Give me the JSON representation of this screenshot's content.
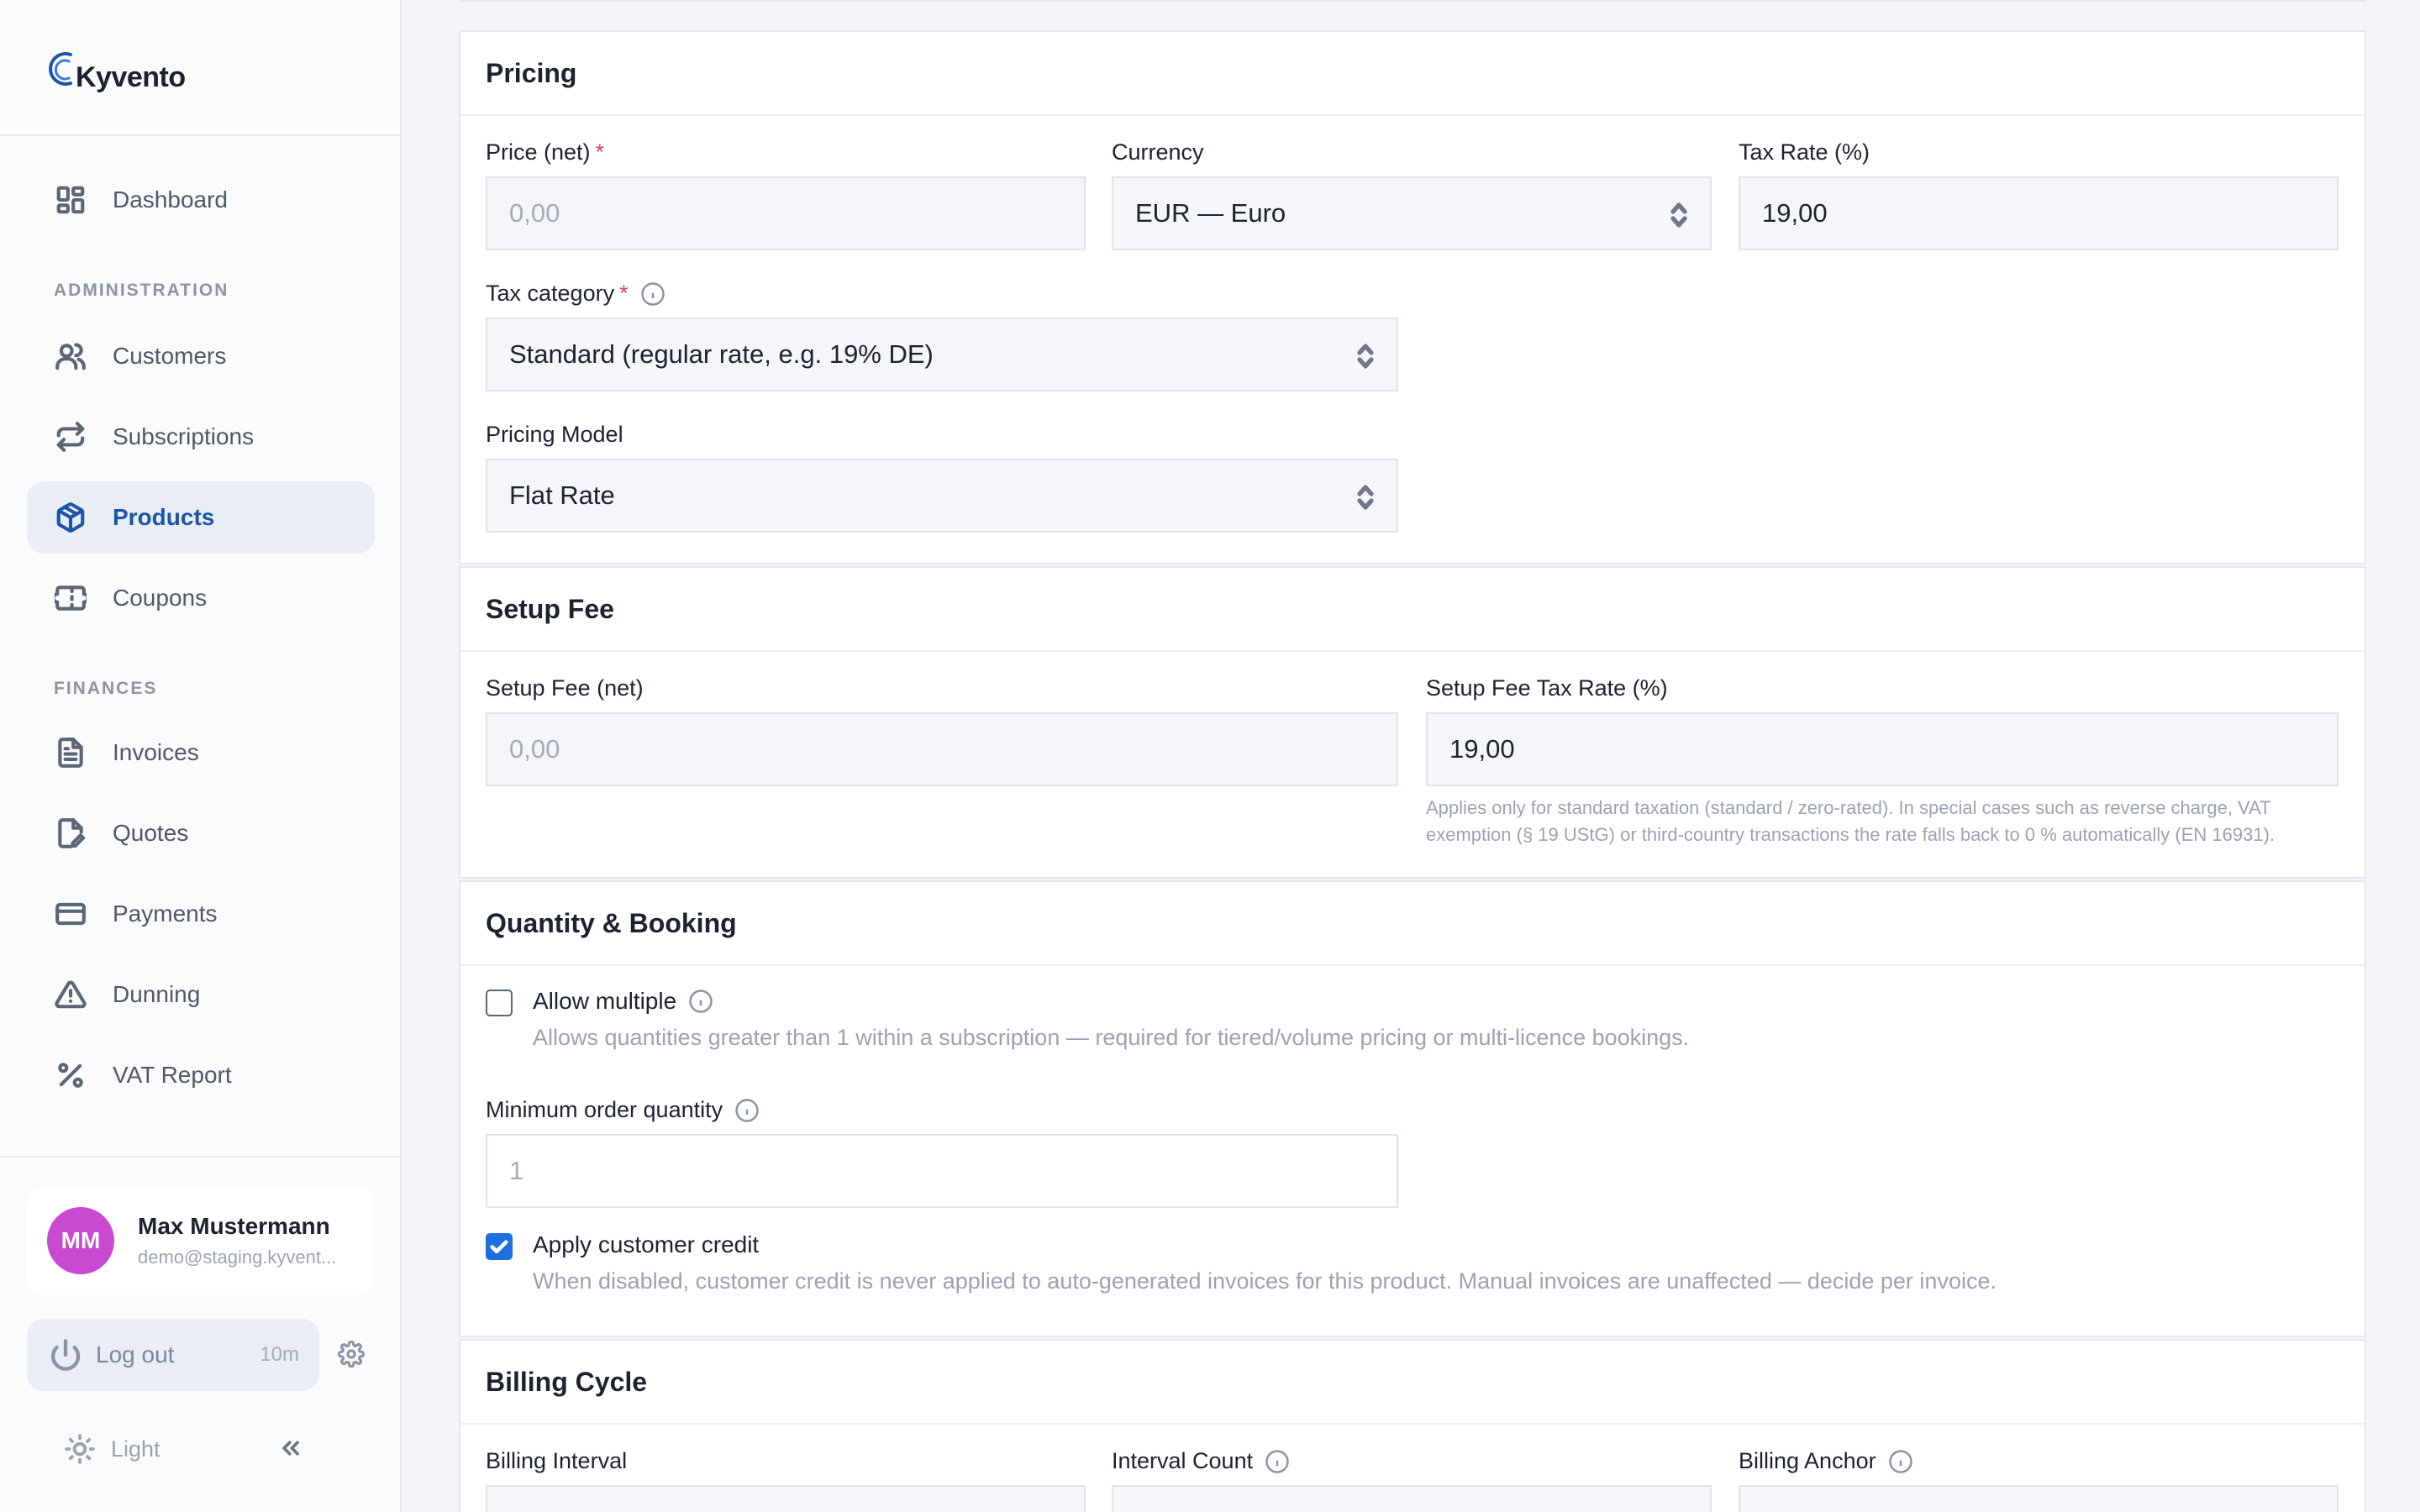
{
  "app": {
    "name": "Kyvento"
  },
  "sidebar": {
    "top_items": [
      {
        "label": "Dashboard",
        "icon": "dashboard-icon"
      }
    ],
    "sections": [
      {
        "title": "ADMINISTRATION",
        "items": [
          {
            "label": "Customers",
            "icon": "users-icon"
          },
          {
            "label": "Subscriptions",
            "icon": "repeat-icon"
          },
          {
            "label": "Products",
            "icon": "box-icon",
            "active": true
          },
          {
            "label": "Coupons",
            "icon": "ticket-icon"
          }
        ]
      },
      {
        "title": "FINANCES",
        "items": [
          {
            "label": "Invoices",
            "icon": "file-text-icon"
          },
          {
            "label": "Quotes",
            "icon": "file-edit-icon"
          },
          {
            "label": "Payments",
            "icon": "credit-card-icon"
          },
          {
            "label": "Dunning",
            "icon": "warning-icon"
          },
          {
            "label": "VAT Report",
            "icon": "percent-icon"
          }
        ]
      }
    ],
    "user": {
      "initials": "MM",
      "name": "Max Mustermann",
      "email": "demo@staging.kyvent..."
    },
    "logout": {
      "label": "Log out",
      "timer": "10m"
    },
    "theme": {
      "label": "Light"
    }
  },
  "pricing": {
    "title": "Pricing",
    "price_label": "Price (net)",
    "price_placeholder": "0,00",
    "currency_label": "Currency",
    "currency_value": "EUR — Euro",
    "tax_rate_label": "Tax Rate (%)",
    "tax_rate_value": "19,00",
    "tax_category_label": "Tax category",
    "tax_category_value": "Standard (regular rate, e.g. 19% DE)",
    "pricing_model_label": "Pricing Model",
    "pricing_model_value": "Flat Rate"
  },
  "setup_fee": {
    "title": "Setup Fee",
    "fee_label": "Setup Fee (net)",
    "fee_placeholder": "0,00",
    "tax_label": "Setup Fee Tax Rate (%)",
    "tax_value": "19,00",
    "help_line1": "Applies only for standard taxation (standard / zero-rated). In special cases such as reverse charge, VAT",
    "help_line2": "exemption (§ 19 UStG) or third-country transactions the rate falls back to 0 % automatically (EN 16931)."
  },
  "quantity": {
    "title": "Quantity & Booking",
    "allow_multiple_label": "Allow multiple",
    "allow_multiple_checked": false,
    "allow_multiple_desc": "Allows quantities greater than 1 within a subscription — required for tiered/volume pricing or multi-licence bookings.",
    "min_qty_label": "Minimum order quantity",
    "min_qty_placeholder": "1",
    "credit_label": "Apply customer credit",
    "credit_checked": true,
    "credit_desc": "When disabled, customer credit is never applied to auto-generated invoices for this product. Manual invoices are unaffected — decide per invoice."
  },
  "billing": {
    "title": "Billing Cycle",
    "interval_label": "Billing Interval",
    "count_label": "Interval Count",
    "anchor_label": "Billing Anchor"
  }
}
